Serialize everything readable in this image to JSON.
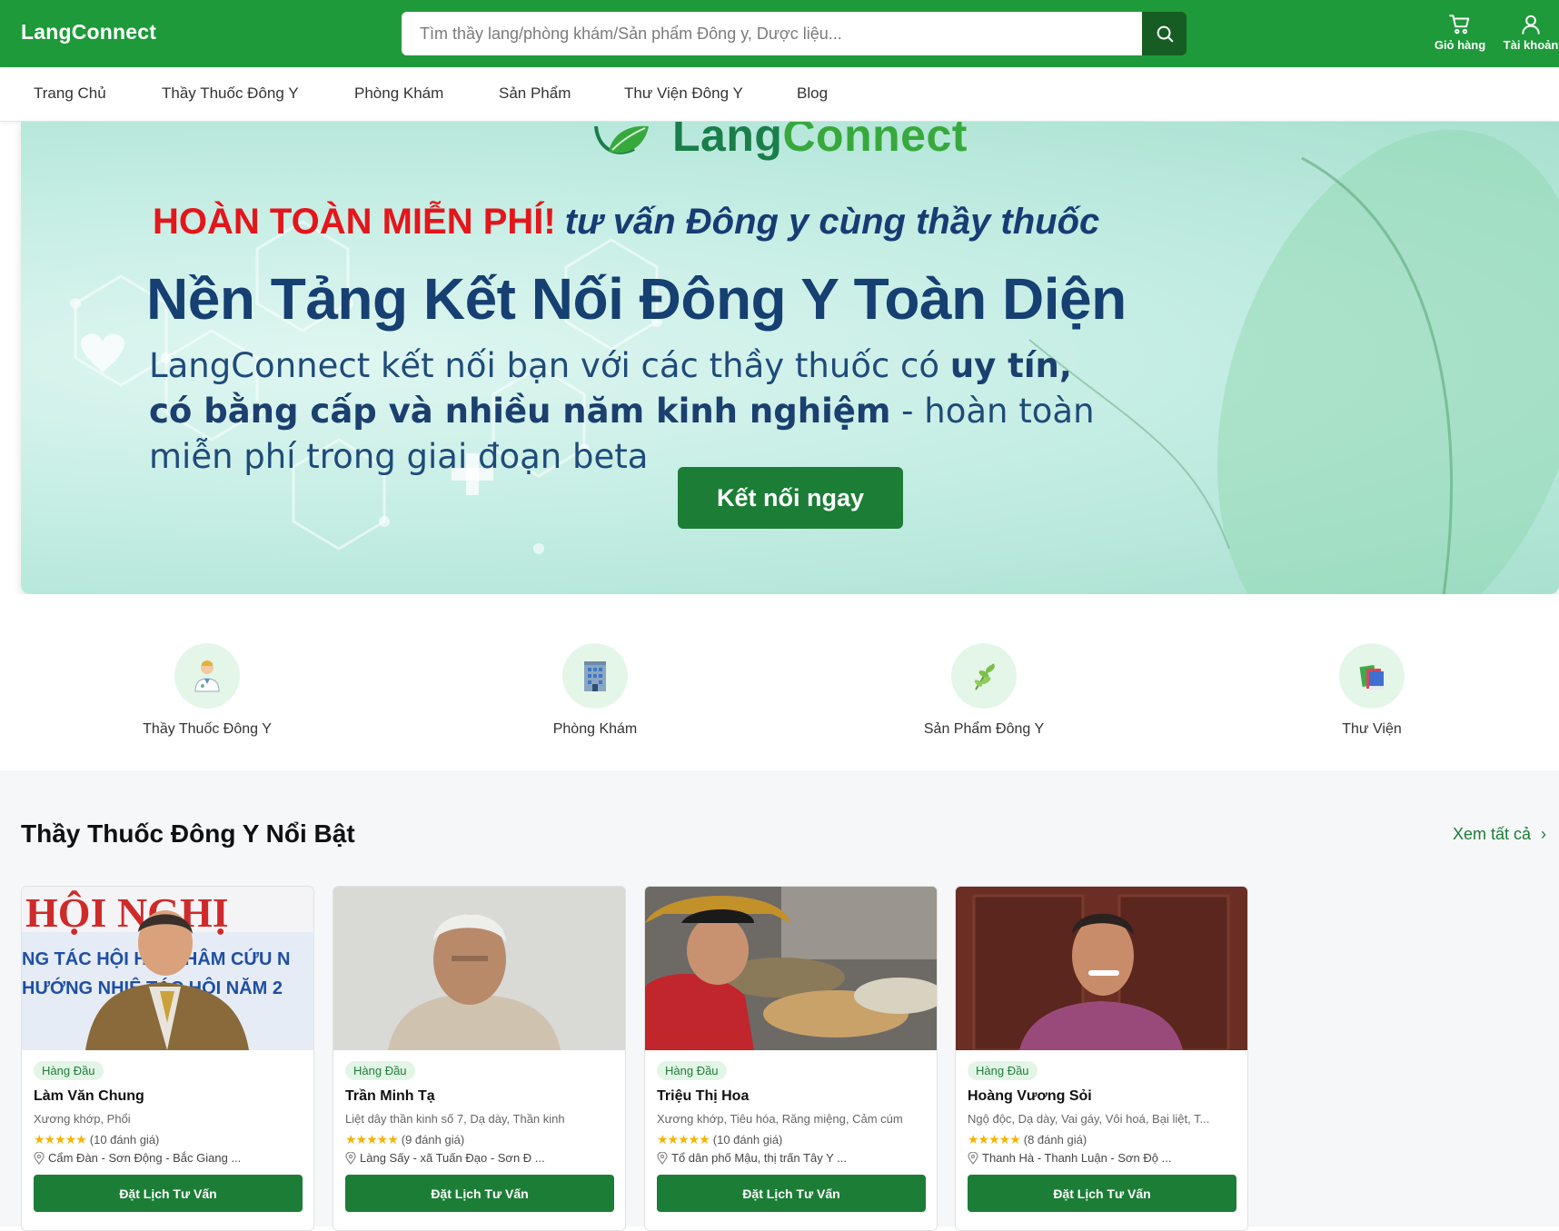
{
  "header": {
    "logo": "LangConnect",
    "search_placeholder": "Tìm thầy lang/phòng khám/Sản phẩm Đông y, Dược liệu...",
    "cart_label": "Giỏ hàng",
    "account_label": "Tài khoản"
  },
  "nav": {
    "items": [
      "Trang Chủ",
      "Thầy Thuốc Đông Y",
      "Phòng Khám",
      "Sản Phẩm",
      "Thư Viện Đông Y",
      "Blog"
    ]
  },
  "hero": {
    "logo_part1": "Lang",
    "logo_part2": "Connect",
    "free": "HOÀN TOÀN MIỄN PHÍ!",
    "tagline": "tư vấn Đông y cùng thầy thuốc",
    "title": "Nền Tảng Kết Nối Đông Y Toàn Diện",
    "desc_1": "LangConnect kết nối bạn với các thầy thuốc có ",
    "desc_bold": "uy tín, có bằng cấp và nhiều năm kinh nghiệm",
    "desc_2": " - hoàn toàn miễn phí trong giai đoạn beta",
    "cta": "Kết nối ngay"
  },
  "categories": [
    {
      "label": "Thầy Thuốc Đông Y",
      "icon": "doctor-icon"
    },
    {
      "label": "Phòng Khám",
      "icon": "clinic-building-icon"
    },
    {
      "label": "Sản Phẩm Đông Y",
      "icon": "herb-icon"
    },
    {
      "label": "Thư Viện",
      "icon": "books-icon"
    }
  ],
  "featured": {
    "title": "Thầy Thuốc Đông Y Nổi Bật",
    "see_all": "Xem tất cả",
    "doctors": [
      {
        "badge": "Hàng Đầu",
        "name": "Làm Văn Chung",
        "specialty": "Xương khớp, Phổi",
        "stars": "★★★★★",
        "reviews": "(10 đánh giá)",
        "location": "Cẩm Đàn - Sơn Động - Bắc Giang ...",
        "button": "Đặt Lịch Tư Vấn"
      },
      {
        "badge": "Hàng Đầu",
        "name": "Trần Minh Tạ",
        "specialty": "Liệt dây thần kinh số 7, Dạ dày, Thần kinh",
        "stars": "★★★★★",
        "reviews": "(9 đánh giá)",
        "location": "Làng Sấy - xã Tuấn Đạo - Sơn Đ ...",
        "button": "Đặt Lịch Tư Vấn"
      },
      {
        "badge": "Hàng Đầu",
        "name": "Triệu Thị Hoa",
        "specialty": "Xương khớp, Tiêu hóa, Răng miệng, Cảm cúm",
        "stars": "★★★★★",
        "reviews": "(10 đánh giá)",
        "location": "Tổ dân phố Mậu, thị trấn Tây Y ...",
        "button": "Đặt Lịch Tư Vấn"
      },
      {
        "badge": "Hàng Đầu",
        "name": "Hoàng Vương Sỏi",
        "specialty": "Ngộ độc, Dạ dày, Vai gáy, Vôi hoá, Bại liệt, T...",
        "stars": "★★★★★",
        "reviews": "(8 đánh giá)",
        "location": "Thanh Hà - Thanh Luận - Sơn Độ ...",
        "button": "Đặt Lịch Tư Vấn"
      }
    ]
  },
  "colors": {
    "brand_green": "#1e9a3a",
    "button_green": "#1c7d36",
    "hero_title": "#163f72",
    "free_red": "#e3161b"
  }
}
